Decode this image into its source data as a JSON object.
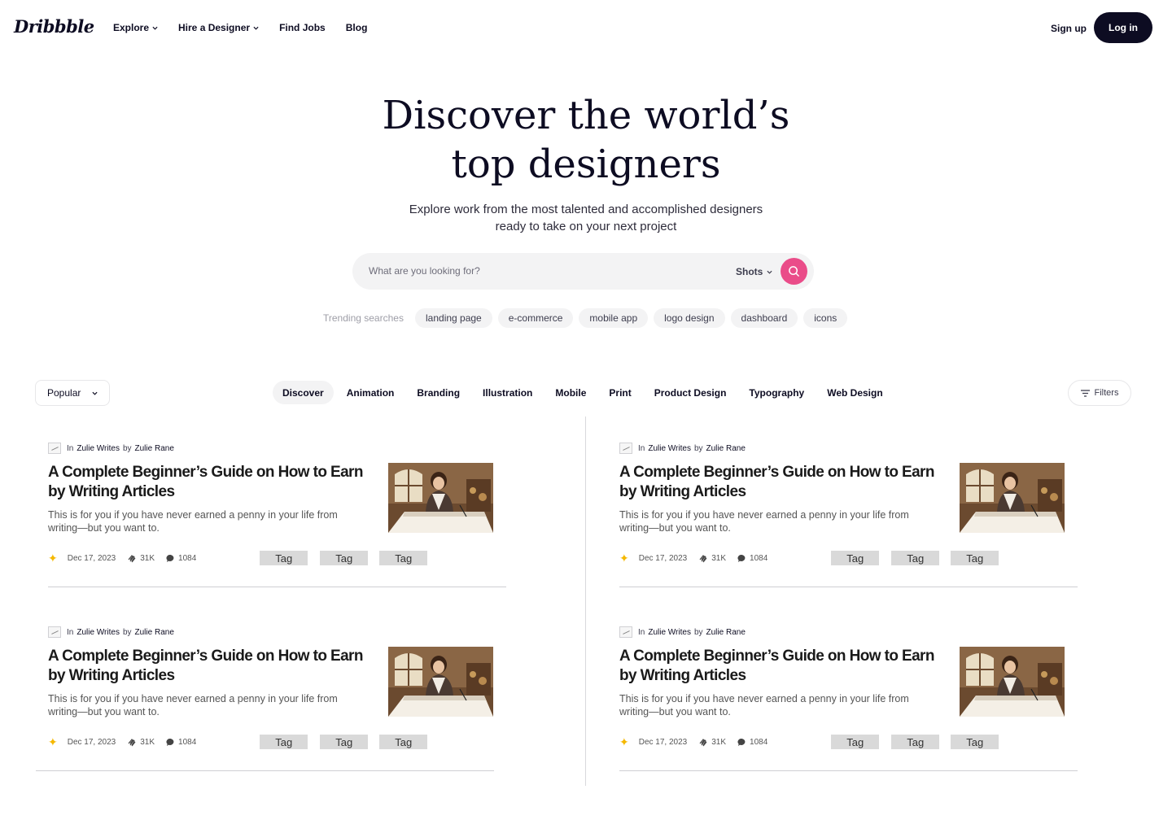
{
  "header": {
    "logo": "Dribbble",
    "nav": [
      {
        "label": "Explore",
        "dropdown": true
      },
      {
        "label": "Hire a Designer",
        "dropdown": true
      },
      {
        "label": "Find Jobs",
        "dropdown": false
      },
      {
        "label": "Blog",
        "dropdown": false
      }
    ],
    "signup": "Sign up",
    "login": "Log in"
  },
  "hero": {
    "title_line1": "Discover the world’s",
    "title_line2": "top designers",
    "subtitle_line1": "Explore work from the most talented and accomplished designers",
    "subtitle_line2": "ready to take on your next project"
  },
  "search": {
    "placeholder": "What are you looking for?",
    "scope": "Shots",
    "button_icon": "search-icon"
  },
  "trending": {
    "label": "Trending searches",
    "items": [
      "landing page",
      "e-commerce",
      "mobile app",
      "logo design",
      "dashboard",
      "icons"
    ]
  },
  "filters": {
    "sort": "Popular",
    "categories": [
      "Discover",
      "Animation",
      "Branding",
      "Illustration",
      "Mobile",
      "Print",
      "Product Design",
      "Typography",
      "Web Design"
    ],
    "active_category": "Discover",
    "filters_label": "Filters"
  },
  "articles": [
    {
      "in_label": "In",
      "publication": "Zulie Writes",
      "by_label": "by",
      "author": "Zulie Rane",
      "title": "A Complete Beginner’s Guide on How to Earn by Writing Articles",
      "excerpt": "This is for you if you have never earned a penny in your life from writing—but you want to.",
      "date": "Dec 17, 2023",
      "claps": "31K",
      "comments": "1084",
      "tags": [
        "Tag",
        "Tag",
        "Tag"
      ]
    },
    {
      "in_label": "In",
      "publication": "Zulie Writes",
      "by_label": "by",
      "author": "Zulie Rane",
      "title": "A Complete Beginner’s Guide on How to Earn by Writing Articles",
      "excerpt": "This is for you if you have never earned a penny in your life from writing—but you want to.",
      "date": "Dec 17, 2023",
      "claps": "31K",
      "comments": "1084",
      "tags": [
        "Tag",
        "Tag",
        "Tag"
      ]
    },
    {
      "in_label": "In",
      "publication": "Zulie Writes",
      "by_label": "by",
      "author": "Zulie Rane",
      "title": "A Complete Beginner’s Guide on How to Earn by Writing Articles",
      "excerpt": "This is for you if you have never earned a penny in your life from writing—but you want to.",
      "date": "Dec 17, 2023",
      "claps": "31K",
      "comments": "1084",
      "tags": [
        "Tag",
        "Tag",
        "Tag"
      ]
    },
    {
      "in_label": "In",
      "publication": "Zulie Writes",
      "by_label": "by",
      "author": "Zulie Rane",
      "title": "A Complete Beginner’s Guide on How to Earn by Writing Articles",
      "excerpt": "This is for you if you have never earned a penny in your life from writing—but you want to.",
      "date": "Dec 17, 2023",
      "claps": "31K",
      "comments": "1084",
      "tags": [
        "Tag",
        "Tag",
        "Tag"
      ]
    }
  ],
  "colors": {
    "brand_dark": "#0d0c22",
    "accent_pink": "#ea4c89",
    "star_yellow": "#f5b800",
    "chip_bg": "#f3f3f4",
    "tag_bg": "#d9d9d9"
  }
}
